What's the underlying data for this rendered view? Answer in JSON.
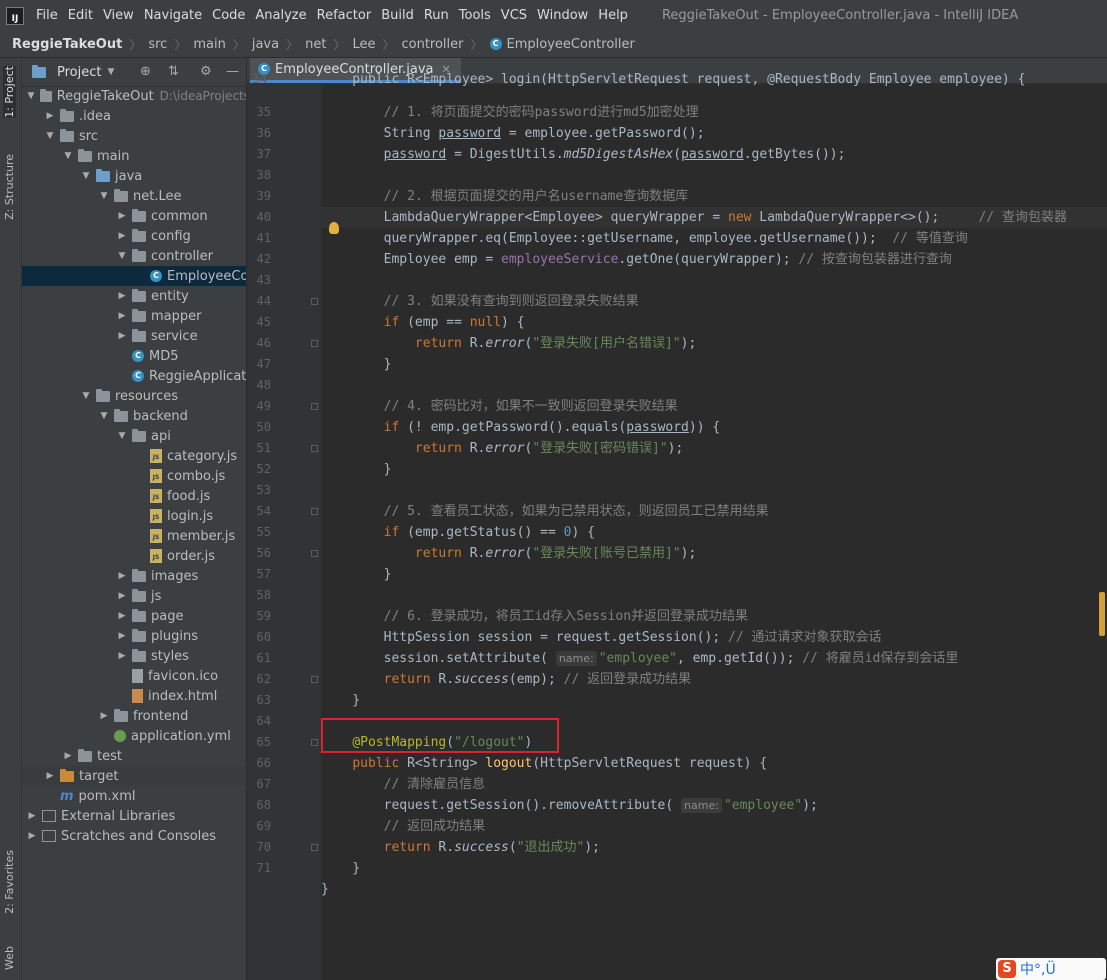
{
  "menubar": {
    "items": [
      "File",
      "Edit",
      "View",
      "Navigate",
      "Code",
      "Analyze",
      "Refactor",
      "Build",
      "Run",
      "Tools",
      "VCS",
      "Window",
      "Help"
    ],
    "window_title": "ReggieTakeOut - EmployeeController.java - IntelliJ IDEA"
  },
  "breadcrumb": [
    "ReggieTakeOut",
    "src",
    "main",
    "java",
    "net",
    "Lee",
    "controller",
    "EmployeeController"
  ],
  "side_tabs": {
    "project": "1: Project",
    "structure": "Z: Structure",
    "favorites": "2: Favorites",
    "web": "Web"
  },
  "project_panel": {
    "title": "Project",
    "tree": [
      {
        "label": "ReggieTakeOut",
        "extra": "D:\\ideaProjects",
        "icon": "folder-gray",
        "depth": 0,
        "open": true
      },
      {
        "label": ".idea",
        "icon": "folder-gray",
        "depth": 1,
        "open": false
      },
      {
        "label": "src",
        "icon": "folder-gray",
        "depth": 1,
        "open": true
      },
      {
        "label": "main",
        "icon": "folder-gray",
        "depth": 2,
        "open": true
      },
      {
        "label": "java",
        "icon": "folder-blue",
        "depth": 3,
        "open": true
      },
      {
        "label": "net.Lee",
        "icon": "folder-gray",
        "depth": 4,
        "open": true
      },
      {
        "label": "common",
        "icon": "folder-gray",
        "depth": 5,
        "open": false
      },
      {
        "label": "config",
        "icon": "folder-gray",
        "depth": 5,
        "open": false
      },
      {
        "label": "controller",
        "icon": "folder-gray",
        "depth": 5,
        "open": true
      },
      {
        "label": "EmployeeController",
        "icon": "class",
        "depth": 6,
        "leaf": true,
        "selected": true
      },
      {
        "label": "entity",
        "icon": "folder-gray",
        "depth": 5,
        "open": false
      },
      {
        "label": "mapper",
        "icon": "folder-gray",
        "depth": 5,
        "open": false
      },
      {
        "label": "service",
        "icon": "folder-gray",
        "depth": 5,
        "open": false
      },
      {
        "label": "MD5",
        "icon": "class",
        "depth": 5,
        "leaf": true
      },
      {
        "label": "ReggieApplication",
        "icon": "class",
        "depth": 5,
        "leaf": true
      },
      {
        "label": "resources",
        "icon": "folder-gray",
        "depth": 3,
        "open": true
      },
      {
        "label": "backend",
        "icon": "folder-gray",
        "depth": 4,
        "open": true
      },
      {
        "label": "api",
        "icon": "folder-gray",
        "depth": 5,
        "open": true
      },
      {
        "label": "category.js",
        "icon": "js",
        "depth": 6,
        "leaf": true
      },
      {
        "label": "combo.js",
        "icon": "js",
        "depth": 6,
        "leaf": true
      },
      {
        "label": "food.js",
        "icon": "js",
        "depth": 6,
        "leaf": true
      },
      {
        "label": "login.js",
        "icon": "js",
        "depth": 6,
        "leaf": true
      },
      {
        "label": "member.js",
        "icon": "js",
        "depth": 6,
        "leaf": true
      },
      {
        "label": "order.js",
        "icon": "js",
        "depth": 6,
        "leaf": true
      },
      {
        "label": "images",
        "icon": "folder-gray",
        "depth": 5,
        "open": false
      },
      {
        "label": "js",
        "icon": "folder-gray",
        "depth": 5,
        "open": false
      },
      {
        "label": "page",
        "icon": "folder-gray",
        "depth": 5,
        "open": false
      },
      {
        "label": "plugins",
        "icon": "folder-gray",
        "depth": 5,
        "open": false
      },
      {
        "label": "styles",
        "icon": "folder-gray",
        "depth": 5,
        "open": false
      },
      {
        "label": "favicon.ico",
        "icon": "file",
        "depth": 5,
        "leaf": true
      },
      {
        "label": "index.html",
        "icon": "html",
        "depth": 5,
        "leaf": true
      },
      {
        "label": "frontend",
        "icon": "folder-gray",
        "depth": 4,
        "open": false
      },
      {
        "label": "application.yml",
        "icon": "yml",
        "depth": 4,
        "leaf": true
      },
      {
        "label": "test",
        "icon": "folder-gray",
        "depth": 2,
        "open": false
      },
      {
        "label": "target",
        "icon": "folder-orange",
        "depth": 1,
        "open": false,
        "target": true
      },
      {
        "label": "pom.xml",
        "icon": "maven",
        "depth": 1,
        "leaf": true
      },
      {
        "label": "External Libraries",
        "icon": "lib",
        "depth": 0,
        "open": false
      },
      {
        "label": "Scratches and Consoles",
        "icon": "lib",
        "depth": 0,
        "open": false
      }
    ]
  },
  "editor": {
    "tab_label": "EmployeeController.java",
    "line_numbers": [
      "35",
      "36",
      "37",
      "38",
      "39",
      "40",
      "41",
      "42",
      "43",
      "44",
      "45",
      "46",
      "47",
      "48",
      "49",
      "50",
      "51",
      "52",
      "53",
      "54",
      "55",
      "56",
      "57",
      "58",
      "59",
      "60",
      "61",
      "62",
      "63",
      "64",
      "65",
      "66",
      "67",
      "68",
      "69",
      "70",
      "71"
    ],
    "partial_line_number": "34",
    "partial_line": "public R<Employee> login(HttpServletRequest request, @RequestBody Employee employee) {",
    "lines": [
      [
        {
          "t": "        "
        },
        {
          "t": "// 1. 将页面提交的密码password进行md5加密处理",
          "c": "cm"
        }
      ],
      [
        {
          "t": "        String "
        },
        {
          "t": "password",
          "c": "ul"
        },
        {
          "t": " = employee.getPassword();"
        }
      ],
      [
        {
          "t": "        "
        },
        {
          "t": "password",
          "c": "ul"
        },
        {
          "t": " = DigestUtils."
        },
        {
          "t": "md5DigestAsHex",
          "c": "it"
        },
        {
          "t": "("
        },
        {
          "t": "password",
          "c": "ul"
        },
        {
          "t": ".getBytes());"
        }
      ],
      [
        {
          "t": ""
        }
      ],
      [
        {
          "t": "        "
        },
        {
          "t": "// 2. 根据页面提交的用户名username查询数据库",
          "c": "cm"
        }
      ],
      [
        {
          "t": "        LambdaQueryWrapper<Employee> queryWrapper = "
        },
        {
          "t": "new",
          "c": "kw"
        },
        {
          "t": " LambdaQueryWrapper<>();     "
        },
        {
          "t": "// 查询包装器",
          "c": "cm"
        }
      ],
      [
        {
          "t": "        queryWrapper.eq(Employee::getUsername, employee.getUsername());  "
        },
        {
          "t": "// 等值查询",
          "c": "cm"
        }
      ],
      [
        {
          "t": "        Employee emp = "
        },
        {
          "t": "employeeService",
          "c": "fld"
        },
        {
          "t": ".getOne(queryWrapper); "
        },
        {
          "t": "// 按查询包装器进行查询",
          "c": "cm"
        }
      ],
      [
        {
          "t": ""
        }
      ],
      [
        {
          "t": "        "
        },
        {
          "t": "// 3. 如果没有查询到则返回登录失败结果",
          "c": "cm"
        }
      ],
      [
        {
          "t": "        "
        },
        {
          "t": "if",
          "c": "kw"
        },
        {
          "t": " (emp == "
        },
        {
          "t": "null",
          "c": "kw"
        },
        {
          "t": ") {"
        }
      ],
      [
        {
          "t": "            "
        },
        {
          "t": "return",
          "c": "kw"
        },
        {
          "t": " R."
        },
        {
          "t": "error",
          "c": "it"
        },
        {
          "t": "("
        },
        {
          "t": "\"登录失败[用户名错误]\"",
          "c": "str"
        },
        {
          "t": ");"
        }
      ],
      [
        {
          "t": "        }"
        }
      ],
      [
        {
          "t": ""
        }
      ],
      [
        {
          "t": "        "
        },
        {
          "t": "// 4. 密码比对，如果不一致则返回登录失败结果",
          "c": "cm"
        }
      ],
      [
        {
          "t": "        "
        },
        {
          "t": "if",
          "c": "kw"
        },
        {
          "t": " (! emp.getPassword().equals("
        },
        {
          "t": "password",
          "c": "ul"
        },
        {
          "t": ")) {"
        }
      ],
      [
        {
          "t": "            "
        },
        {
          "t": "return",
          "c": "kw"
        },
        {
          "t": " R."
        },
        {
          "t": "error",
          "c": "it"
        },
        {
          "t": "("
        },
        {
          "t": "\"登录失败[密码错误]\"",
          "c": "str"
        },
        {
          "t": ");"
        }
      ],
      [
        {
          "t": "        }"
        }
      ],
      [
        {
          "t": ""
        }
      ],
      [
        {
          "t": "        "
        },
        {
          "t": "// 5. 查看员工状态，如果为已禁用状态，则返回员工已禁用结果",
          "c": "cm"
        }
      ],
      [
        {
          "t": "        "
        },
        {
          "t": "if",
          "c": "kw"
        },
        {
          "t": " (emp.getStatus() == "
        },
        {
          "t": "0",
          "c": "num"
        },
        {
          "t": ") {"
        }
      ],
      [
        {
          "t": "            "
        },
        {
          "t": "return",
          "c": "kw"
        },
        {
          "t": " R."
        },
        {
          "t": "error",
          "c": "it"
        },
        {
          "t": "("
        },
        {
          "t": "\"登录失败[账号已禁用]\"",
          "c": "str"
        },
        {
          "t": ");"
        }
      ],
      [
        {
          "t": "        }"
        }
      ],
      [
        {
          "t": ""
        }
      ],
      [
        {
          "t": "        "
        },
        {
          "t": "// 6. 登录成功，将员工id存入Session并返回登录成功结果",
          "c": "cm"
        }
      ],
      [
        {
          "t": "        HttpSession session = request.getSession(); "
        },
        {
          "t": "// 通过请求对象获取会话",
          "c": "cm"
        }
      ],
      [
        {
          "t": "        session.setAttribute( "
        },
        {
          "t": "name:",
          "c": "hint"
        },
        {
          "t": "\"employee\"",
          "c": "str"
        },
        {
          "t": ", emp.getId()); "
        },
        {
          "t": "// 将雇员id保存到会话里",
          "c": "cm"
        }
      ],
      [
        {
          "t": "        "
        },
        {
          "t": "return",
          "c": "kw"
        },
        {
          "t": " R."
        },
        {
          "t": "success",
          "c": "it"
        },
        {
          "t": "(emp); "
        },
        {
          "t": "// 返回登录成功结果",
          "c": "cm"
        }
      ],
      [
        {
          "t": "    }"
        }
      ],
      [
        {
          "t": ""
        }
      ],
      [
        {
          "t": "    "
        },
        {
          "t": "@PostMapping",
          "c": "ann"
        },
        {
          "t": "("
        },
        {
          "t": "\"/logout\"",
          "c": "str"
        },
        {
          "t": ")"
        }
      ],
      [
        {
          "t": "    "
        },
        {
          "t": "public",
          "c": "kw"
        },
        {
          "t": " R<String> "
        },
        {
          "t": "logout",
          "c": "fn"
        },
        {
          "t": "(HttpServletRequest request) {"
        }
      ],
      [
        {
          "t": "        "
        },
        {
          "t": "// 清除雇员信息",
          "c": "cm"
        }
      ],
      [
        {
          "t": "        request.getSession().removeAttribute( "
        },
        {
          "t": "name:",
          "c": "hint"
        },
        {
          "t": "\"employee\"",
          "c": "str"
        },
        {
          "t": ");"
        }
      ],
      [
        {
          "t": "        "
        },
        {
          "t": "// 返回成功结果",
          "c": "cm"
        }
      ],
      [
        {
          "t": "        "
        },
        {
          "t": "return",
          "c": "kw"
        },
        {
          "t": " R."
        },
        {
          "t": "success",
          "c": "it"
        },
        {
          "t": "("
        },
        {
          "t": "\"退出成功\"",
          "c": "str"
        },
        {
          "t": ");"
        }
      ],
      [
        {
          "t": "    }"
        }
      ],
      [
        {
          "t": "}"
        }
      ]
    ]
  },
  "ime": {
    "label": "中°,Ü"
  },
  "colors": {
    "highlight_box": "#e0202a",
    "accent": "#4a88c7"
  }
}
